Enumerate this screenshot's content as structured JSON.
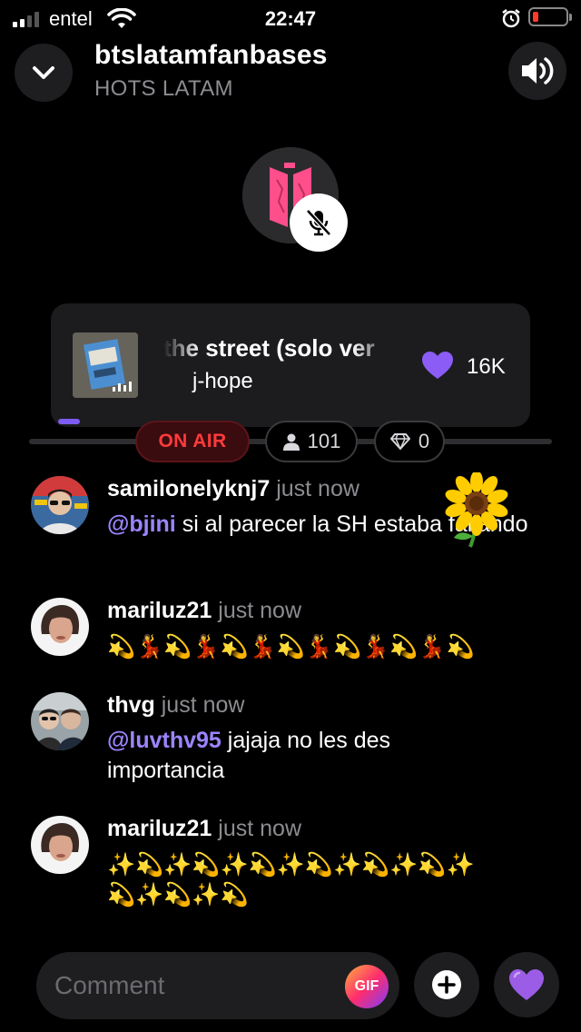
{
  "status_bar": {
    "carrier": "entel",
    "time": "22:47",
    "signal_bars": 2,
    "battery_level": 0.1
  },
  "header": {
    "room_name": "btslatamfanbases",
    "subtitle": "HOTS LATAM",
    "collapse_icon": "chevron-down-icon",
    "volume_icon": "speaker-icon"
  },
  "host": {
    "avatar_icon": "bts-logo-avatar",
    "mic_status_icon": "mic-muted-icon"
  },
  "now_playing": {
    "title": "the street (solo ver",
    "artist": "j-hope",
    "likes": "16K",
    "accent": "#8b5cf6"
  },
  "stats": {
    "on_air": "ON AIR",
    "listeners": "101",
    "gems": "0"
  },
  "messages": [
    {
      "username": "samilonelyknj7",
      "time": "just now",
      "mention": "@bjini",
      "text": " si al parecer la SH estaba fallando",
      "reaction": "🌻"
    },
    {
      "username": "mariluz21",
      "time": "just now",
      "emoji_line_1": "💫💃💫💃💫💃💫💃💫💃💫💃💫"
    },
    {
      "username": "thvg",
      "time": "just now",
      "mention": "@luvthv95",
      "text": " jajaja no les des importancia"
    },
    {
      "username": "mariluz21",
      "time": "just now",
      "emoji_line_1": "✨💫✨💫✨💫✨💫✨💫✨💫✨",
      "emoji_line_2": "💫✨💫✨💫"
    }
  ],
  "composer": {
    "placeholder": "Comment",
    "gif_label": "GIF",
    "add_icon": "plus-icon",
    "heart_emoji": "💜"
  },
  "colors": {
    "background": "#000000",
    "card": "#1c1c1f",
    "accent_purple": "#8b5cf6",
    "mention": "#9c84ff",
    "on_air_red": "#ff3b3b",
    "muted_text": "#8c8c91"
  }
}
